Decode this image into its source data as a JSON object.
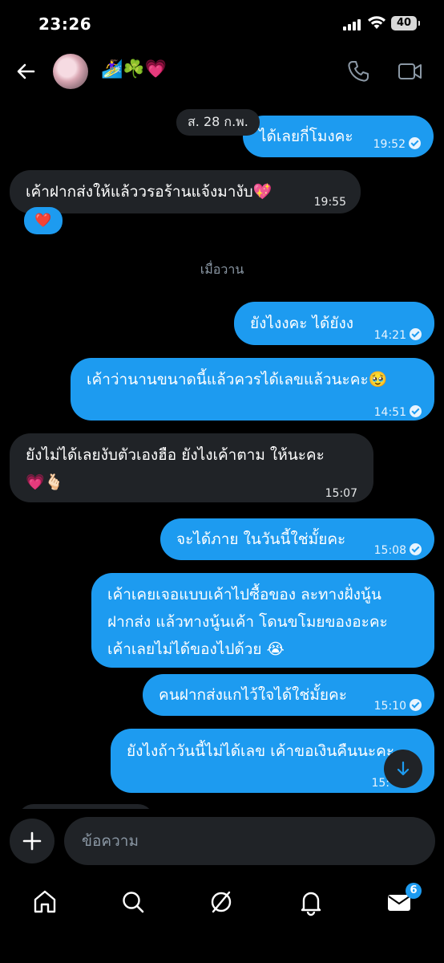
{
  "status": {
    "time": "23:26",
    "battery": "40"
  },
  "header": {
    "name": "🏄‍♀️☘️💗"
  },
  "chat": {
    "date_pill": "ส. 28 ก.พ.",
    "divider": "เมื่อวาน",
    "messages": [
      {
        "dir": "out",
        "text": "ได้เลยกี่โมงคะ",
        "time": "19:52"
      },
      {
        "dir": "in",
        "text": "เค้าฝากส่งให้แล้ววรอร้านแจ้งมางับ💖",
        "time": "19:55",
        "reaction": "❤️"
      },
      {
        "dir": "out",
        "text": "ยังไงงคะ ได้ยังง",
        "time": "14:21"
      },
      {
        "dir": "out",
        "text": "เค้าว่านานขนาดนี้แล้วควรได้เลขแล้วนะคะ🥹",
        "time": "14:51"
      },
      {
        "dir": "in",
        "line1": "ยังไม่ได้เลยงับตัวเองฮือ ยังไงเค้าตาม ให้นะคะ",
        "line2": "💗🫰🏻",
        "time": "15:07"
      },
      {
        "dir": "out",
        "text": "จะได้ภาย ในวันนี้ใช่มั้ยคะ",
        "time": "15:08"
      },
      {
        "dir": "out",
        "line1": "เค้าเคยเจอแบบเค้าไปซื้อของ ละทางฝั่งนู้น",
        "line2": "ฝากส่ง แล้วทางนู้นเค้า โดนขโมยของอะคะ",
        "line3": "เค้าเลยไม่ได้ของไปด้วย 😭"
      },
      {
        "dir": "out",
        "text": "คนฝากส่งแกไว้ใจได้ใช่มั้ยคะ",
        "time": "15:10"
      },
      {
        "dir": "out",
        "text": "ยังไงถ้าวันนี้ไม่ได้เลข เค้าขอเงินคืนนะคะ",
        "time": "15:"
      }
    ]
  },
  "composer": {
    "placeholder": "ข้อความ"
  },
  "nav": {
    "badge": "6"
  },
  "colors": {
    "accent": "#1d9bf0",
    "bubble_in": "#202327",
    "background": "#000000"
  },
  "icons": [
    "back-arrow-icon",
    "phone-icon",
    "video-camera-icon",
    "check-circle-icon",
    "arrow-down-icon",
    "plus-icon",
    "home-icon",
    "search-icon",
    "grok-icon",
    "bell-icon",
    "mail-icon"
  ]
}
